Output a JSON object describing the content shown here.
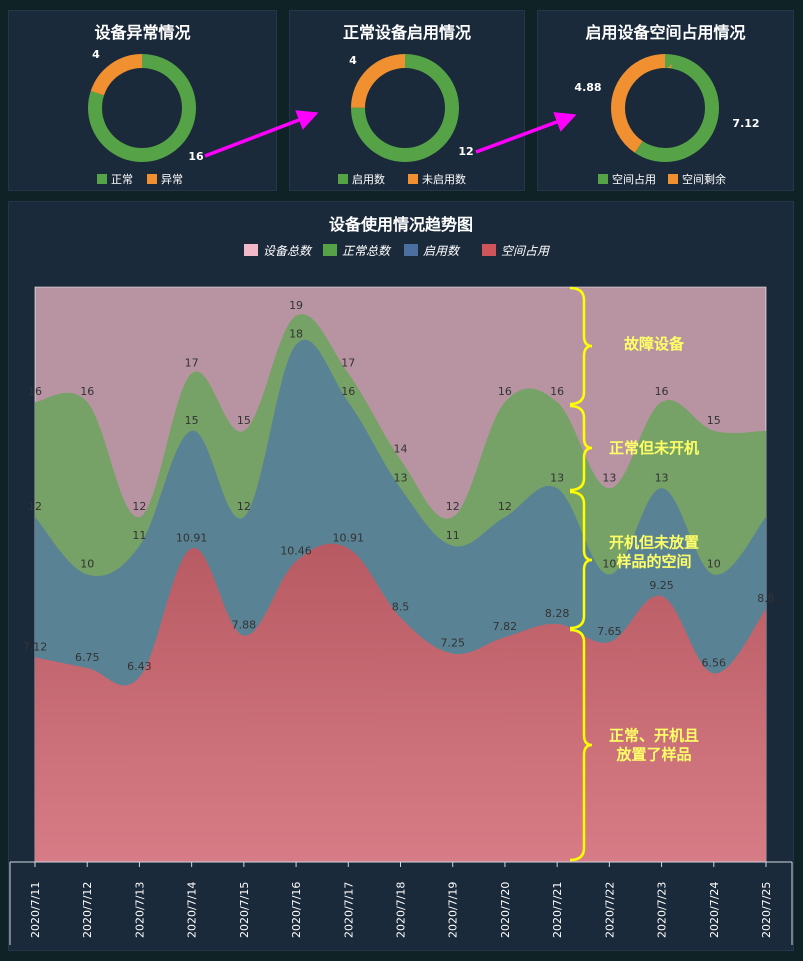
{
  "colors": {
    "green": "#55a346",
    "orange": "#f09030",
    "blue": "#4a6fa0",
    "red": "#d0555a",
    "pink": "#f0b8c8",
    "arrow": "#ff00ff",
    "brace": "#ffff00",
    "brace_text": "#ffff66"
  },
  "donuts": [
    {
      "title": "设备异常情况",
      "slices": [
        {
          "name": "正常",
          "value": 16,
          "label": "16",
          "color": "#55a346"
        },
        {
          "name": "异常",
          "value": 4,
          "label": "4",
          "color": "#f09030"
        }
      ]
    },
    {
      "title": "正常设备启用情况",
      "slices": [
        {
          "name": "启用数",
          "value": 12,
          "label": "12",
          "color": "#55a346"
        },
        {
          "name": "未启用数",
          "value": 4,
          "label": "4",
          "color": "#f09030"
        }
      ]
    },
    {
      "title": "启用设备空间占用情况",
      "slices": [
        {
          "name": "空间占用",
          "value": 7.12,
          "label": "7.12",
          "color": "#55a346"
        },
        {
          "name": "空间剩余",
          "value": 4.88,
          "label": "4.88",
          "color": "#f09030"
        }
      ]
    }
  ],
  "chart_data": {
    "type": "area",
    "title": "设备使用情况趋势图",
    "categories": [
      "2020/7/11",
      "2020/7/12",
      "2020/7/13",
      "2020/7/14",
      "2020/7/15",
      "2020/7/16",
      "2020/7/17",
      "2020/7/18",
      "2020/7/19",
      "2020/7/20",
      "2020/7/21",
      "2020/7/22",
      "2020/7/23",
      "2020/7/24",
      "2020/7/25"
    ],
    "series": [
      {
        "name": "设备总数",
        "color": "#f0b8c8",
        "values": [
          20,
          20,
          20,
          20,
          20,
          20,
          20,
          20,
          20,
          20,
          20,
          20,
          20,
          20,
          20
        ],
        "labels": [
          "",
          "",
          "",
          "",
          "",
          "",
          "",
          "",
          "",
          "",
          "",
          "",
          "",
          "",
          ""
        ]
      },
      {
        "name": "正常总数",
        "color": "#55a346",
        "values": [
          16,
          16,
          12,
          17,
          15,
          19,
          17,
          14,
          12,
          16,
          16,
          13,
          16,
          15,
          15
        ],
        "labels": [
          "16",
          "16",
          "12",
          "17",
          "15",
          "19",
          "17",
          "14",
          "12",
          "16",
          "16",
          "13",
          "16",
          "15",
          ""
        ]
      },
      {
        "name": "启用数",
        "color": "#4a6fa0",
        "values": [
          12,
          10,
          11,
          15,
          12,
          18,
          16,
          13,
          11,
          12,
          13,
          10,
          13,
          10,
          12
        ],
        "labels": [
          "12",
          "10",
          "11",
          "15",
          "12",
          "18",
          "16",
          "13",
          "11",
          "12",
          "13",
          "10",
          "13",
          "10",
          ""
        ]
      },
      {
        "name": "空间占用",
        "color": "#d0555a",
        "values": [
          7.12,
          6.75,
          6.43,
          10.91,
          7.88,
          10.46,
          10.91,
          8.5,
          7.25,
          7.82,
          8.28,
          7.65,
          9.25,
          6.56,
          8.8
        ],
        "labels": [
          "7.12",
          "6.75",
          "6.43",
          "10.91",
          "7.88",
          "10.46",
          "10.91",
          "8.5",
          "7.25",
          "7.82",
          "8.28",
          "7.65",
          "9.25",
          "6.56",
          "8.8"
        ]
      }
    ],
    "ylim": [
      0,
      20
    ],
    "legend_position": "top",
    "annotations": [
      "故障设备",
      "正常但未开机",
      "开机但未放置\n样品的空间",
      "正常、开机且\n放置了样品"
    ]
  }
}
